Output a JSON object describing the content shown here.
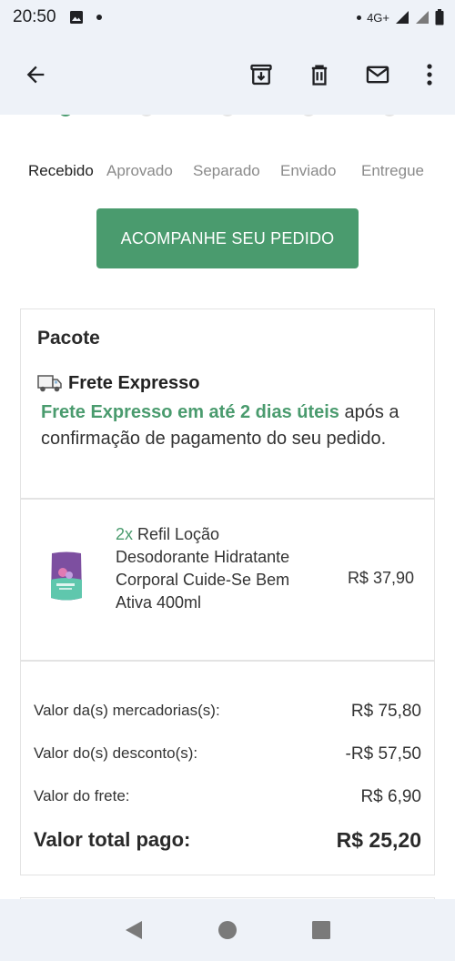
{
  "status_bar": {
    "time": "20:50",
    "network": "4G+"
  },
  "app_bar": {
    "icons": [
      "back-arrow-icon",
      "archive-icon",
      "delete-icon",
      "mail-icon",
      "more-vert-icon"
    ]
  },
  "order_steps": {
    "steps": [
      "Recebido",
      "Aprovado",
      "Separado",
      "Enviado",
      "Entregue"
    ],
    "active_index": 0
  },
  "track_button": {
    "label": "ACOMPANHE SEU PEDIDO"
  },
  "package": {
    "title": "Pacote",
    "shipping_title": "Frete Expresso",
    "shipping_highlight": "Frete Expresso em até 2 dias úteis",
    "shipping_rest": " após a confirmação de pagamento do seu pedido."
  },
  "item": {
    "quantity": "2x",
    "name": " Refil Loção Desodorante Hidratante Corporal Cuide-Se Bem Ativa 400ml",
    "price": "R$ 37,90"
  },
  "totals": {
    "merch_label": "Valor da(s) mercadorias(s):",
    "merch_value": "R$ 75,80",
    "discount_label": "Valor do(s) desconto(s):",
    "discount_value": "-R$ 57,50",
    "shipping_label": "Valor do frete:",
    "shipping_value": "R$ 6,90",
    "total_label": "Valor total pago:",
    "total_value": "R$ 25,20"
  },
  "colors": {
    "accent_green": "#4a9b6e",
    "bar_background": "#eef2f8"
  }
}
